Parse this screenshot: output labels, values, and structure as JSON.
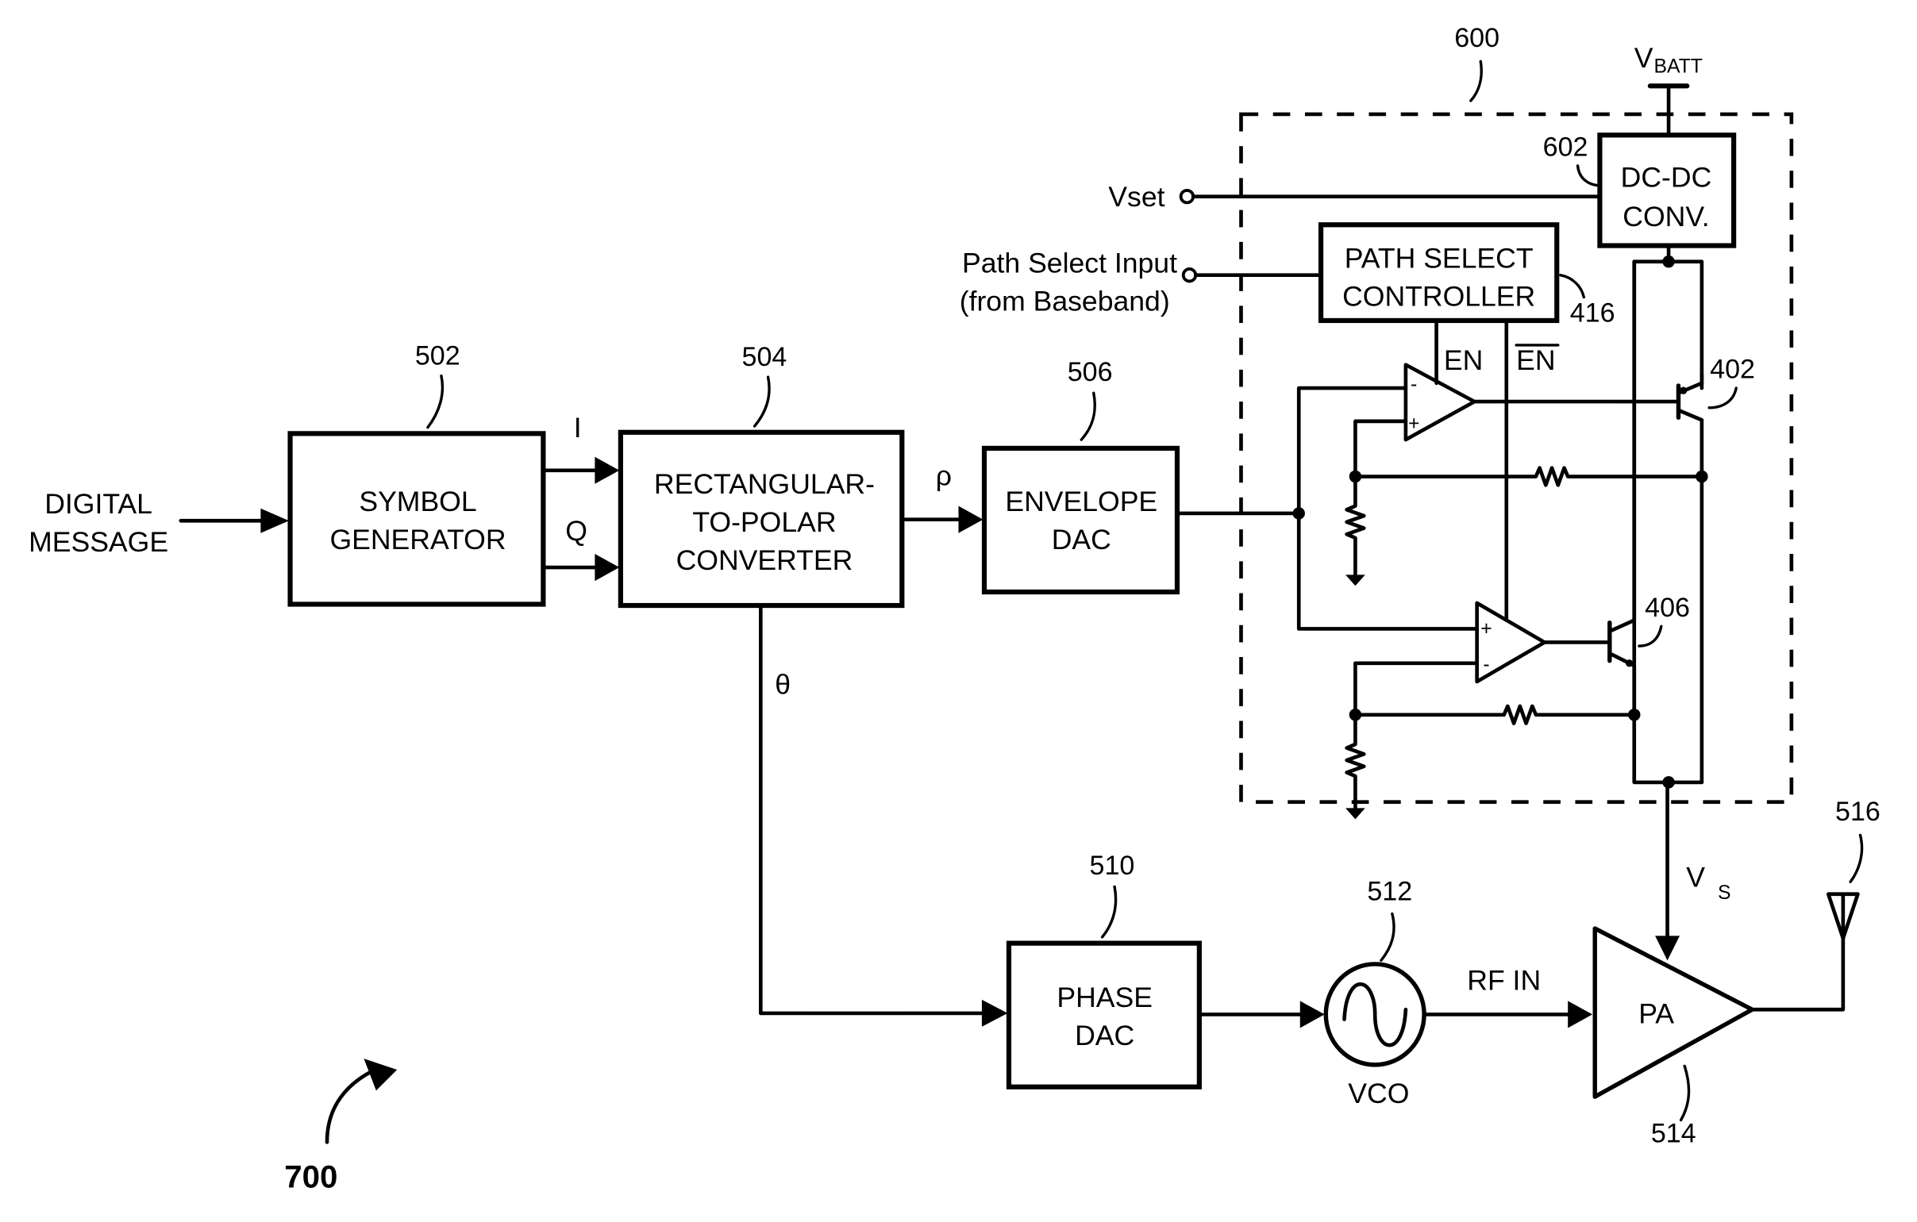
{
  "figure": {
    "number": "700",
    "type": "polar transmitter block diagram"
  },
  "inputs": {
    "digital_message": [
      "DIGITAL",
      "MESSAGE"
    ],
    "vset": "Vset",
    "path_select": [
      "Path Select Input",
      "(from Baseband)"
    ],
    "vbatt_main": "V",
    "vbatt_sub": "BATT"
  },
  "blocks": {
    "symbol_generator": {
      "ref": "502",
      "lines": [
        "SYMBOL",
        "GENERATOR"
      ]
    },
    "rect_to_polar": {
      "ref": "504",
      "lines": [
        "RECTANGULAR-",
        "TO-POLAR",
        "CONVERTER"
      ]
    },
    "envelope_dac": {
      "ref": "506",
      "lines": [
        "ENVELOPE",
        "DAC"
      ]
    },
    "phase_dac": {
      "ref": "510",
      "lines": [
        "PHASE",
        "DAC"
      ]
    },
    "vco": {
      "ref": "512",
      "label": "VCO"
    },
    "pa": {
      "ref": "514",
      "label": "PA"
    },
    "antenna": {
      "ref": "516"
    },
    "supply_module": {
      "ref": "600"
    },
    "dcdc": {
      "ref": "602",
      "lines": [
        "DC-DC",
        "CONV."
      ]
    },
    "path_select_controller": {
      "ref": "416",
      "lines": [
        "PATH SELECT",
        "CONTROLLER"
      ]
    },
    "transistor_top": {
      "ref": "402"
    },
    "transistor_bottom": {
      "ref": "406"
    }
  },
  "signals": {
    "i": "I",
    "q": "Q",
    "rho": "ρ",
    "theta": "θ",
    "en": "EN",
    "en_bar": "EN",
    "rf_in": "RF IN",
    "vs_main": "V",
    "vs_sub": "S"
  },
  "opamp_signs": {
    "minus": "-",
    "plus": "+"
  }
}
